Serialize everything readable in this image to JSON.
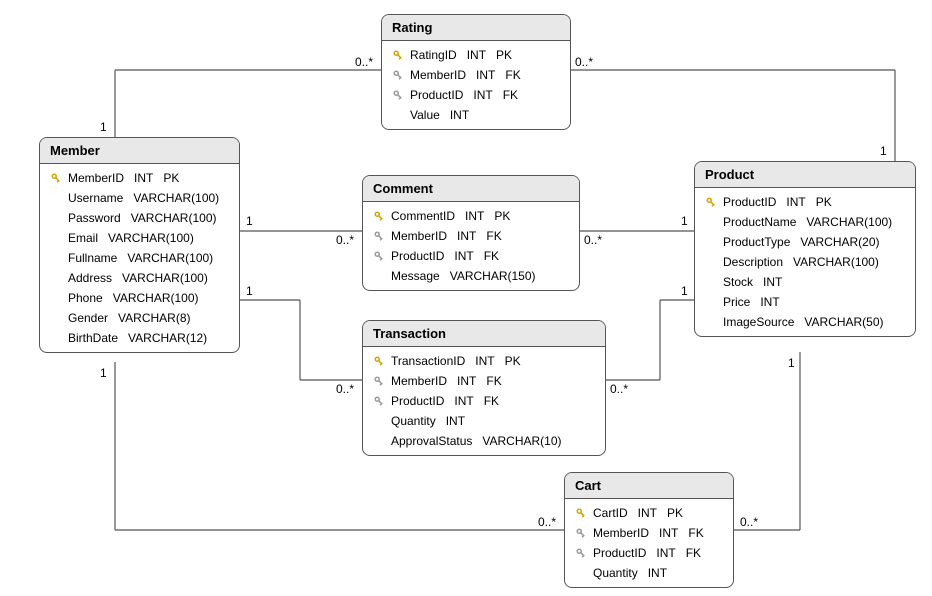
{
  "entities": {
    "member": {
      "title": "Member",
      "attrs": [
        {
          "key": "pk",
          "name": "MemberID",
          "type": "INT",
          "constraint": "PK"
        },
        {
          "key": "",
          "name": "Username",
          "type": "VARCHAR(100)",
          "constraint": ""
        },
        {
          "key": "",
          "name": "Password",
          "type": "VARCHAR(100)",
          "constraint": ""
        },
        {
          "key": "",
          "name": "Email",
          "type": "VARCHAR(100)",
          "constraint": ""
        },
        {
          "key": "",
          "name": "Fullname",
          "type": "VARCHAR(100)",
          "constraint": ""
        },
        {
          "key": "",
          "name": "Address",
          "type": "VARCHAR(100)",
          "constraint": ""
        },
        {
          "key": "",
          "name": "Phone",
          "type": "VARCHAR(100)",
          "constraint": ""
        },
        {
          "key": "",
          "name": "Gender",
          "type": "VARCHAR(8)",
          "constraint": ""
        },
        {
          "key": "",
          "name": "BirthDate",
          "type": "VARCHAR(12)",
          "constraint": ""
        }
      ]
    },
    "rating": {
      "title": "Rating",
      "attrs": [
        {
          "key": "pk",
          "name": "RatingID",
          "type": "INT",
          "constraint": "PK"
        },
        {
          "key": "fk",
          "name": "MemberID",
          "type": "INT",
          "constraint": "FK"
        },
        {
          "key": "fk",
          "name": "ProductID",
          "type": "INT",
          "constraint": "FK"
        },
        {
          "key": "",
          "name": "Value",
          "type": "INT",
          "constraint": ""
        }
      ]
    },
    "comment": {
      "title": "Comment",
      "attrs": [
        {
          "key": "pk",
          "name": "CommentID",
          "type": "INT",
          "constraint": "PK"
        },
        {
          "key": "fk",
          "name": "MemberID",
          "type": "INT",
          "constraint": "FK"
        },
        {
          "key": "fk",
          "name": "ProductID",
          "type": "INT",
          "constraint": "FK"
        },
        {
          "key": "",
          "name": "Message",
          "type": "VARCHAR(150)",
          "constraint": ""
        }
      ]
    },
    "transaction": {
      "title": "Transaction",
      "attrs": [
        {
          "key": "pk",
          "name": "TransactionID",
          "type": "INT",
          "constraint": "PK"
        },
        {
          "key": "fk",
          "name": "MemberID",
          "type": "INT",
          "constraint": "FK"
        },
        {
          "key": "fk",
          "name": "ProductID",
          "type": "INT",
          "constraint": "FK"
        },
        {
          "key": "",
          "name": "Quantity",
          "type": "INT",
          "constraint": ""
        },
        {
          "key": "",
          "name": "ApprovalStatus",
          "type": "VARCHAR(10)",
          "constraint": ""
        }
      ]
    },
    "product": {
      "title": "Product",
      "attrs": [
        {
          "key": "pk",
          "name": "ProductID",
          "type": "INT",
          "constraint": "PK"
        },
        {
          "key": "",
          "name": "ProductName",
          "type": "VARCHAR(100)",
          "constraint": ""
        },
        {
          "key": "",
          "name": "ProductType",
          "type": "VARCHAR(20)",
          "constraint": ""
        },
        {
          "key": "",
          "name": "Description",
          "type": "VARCHAR(100)",
          "constraint": ""
        },
        {
          "key": "",
          "name": "Stock",
          "type": "INT",
          "constraint": ""
        },
        {
          "key": "",
          "name": "Price",
          "type": "INT",
          "constraint": ""
        },
        {
          "key": "",
          "name": "ImageSource",
          "type": "VARCHAR(50)",
          "constraint": ""
        }
      ]
    },
    "cart": {
      "title": "Cart",
      "attrs": [
        {
          "key": "pk",
          "name": "CartID",
          "type": "INT",
          "constraint": "PK"
        },
        {
          "key": "fk",
          "name": "MemberID",
          "type": "INT",
          "constraint": "FK"
        },
        {
          "key": "fk",
          "name": "ProductID",
          "type": "INT",
          "constraint": "FK"
        },
        {
          "key": "",
          "name": "Quantity",
          "type": "INT",
          "constraint": ""
        }
      ]
    }
  },
  "cardinalities": {
    "one": "1",
    "many": "0..*"
  }
}
